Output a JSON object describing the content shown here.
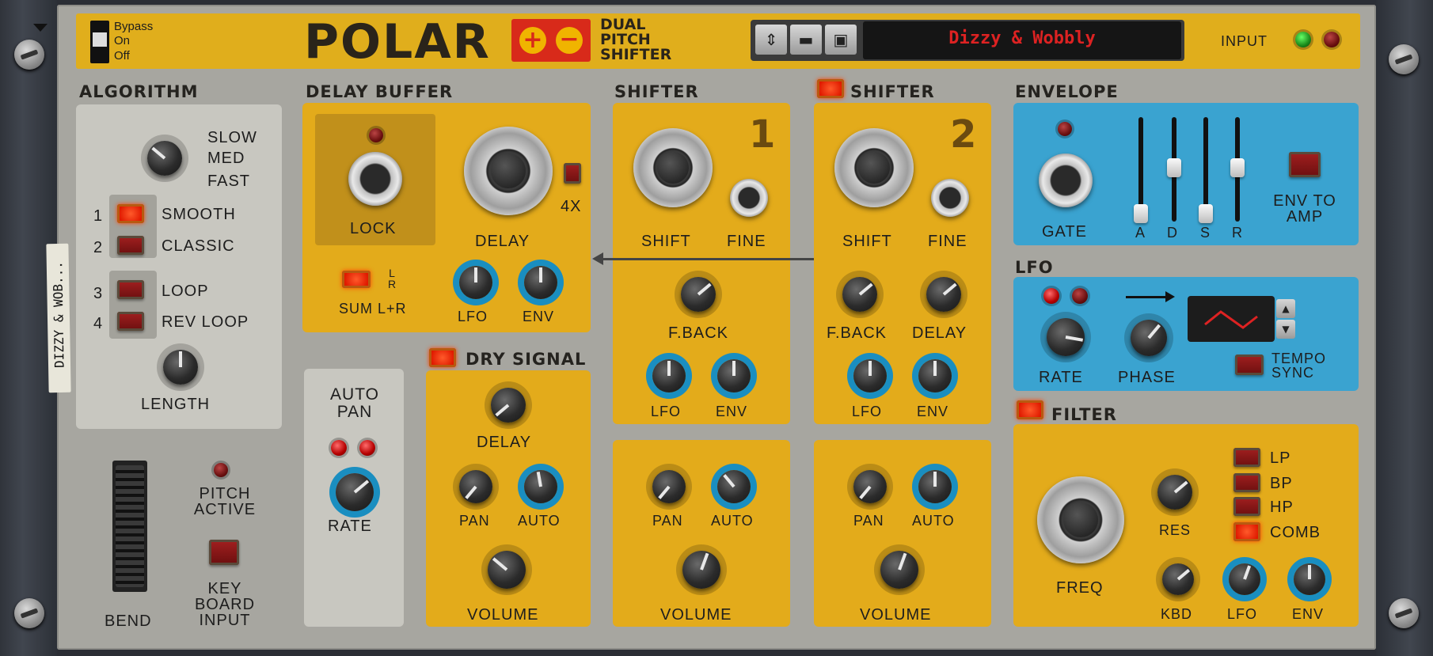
{
  "header": {
    "bypass": "Bypass",
    "on": "On",
    "off": "Off",
    "title": "POLAR",
    "plus": "+",
    "minus": "−",
    "subtitle_1": "DUAL",
    "subtitle_2": "PITCH",
    "subtitle_3": "SHIFTER",
    "patch_name": "Dizzy & Wobbly",
    "input": "INPUT",
    "side_label": "DIZZY & WOB..."
  },
  "algorithm": {
    "header": "ALGORITHM",
    "slow": "SLOW",
    "med": "MED",
    "fast": "FAST",
    "n1": "1",
    "smooth": "SMOOTH",
    "n2": "2",
    "classic": "CLASSIC",
    "n3": "3",
    "loop": "LOOP",
    "n4": "4",
    "rev_loop": "REV LOOP",
    "length": "LENGTH"
  },
  "bend": {
    "bend": "BEND",
    "pitch_active": "PITCH ACTIVE",
    "keyboard_input": "KEY BOARD INPUT"
  },
  "delay_buffer": {
    "header": "DELAY BUFFER",
    "lock": "LOCK",
    "delay": "DELAY",
    "x4": "4X",
    "lr": "L\nR",
    "sum": "SUM L+R",
    "lfo": "LFO",
    "env": "ENV"
  },
  "autopan": {
    "header": "AUTO PAN",
    "rate": "RATE"
  },
  "dry": {
    "header": "DRY SIGNAL",
    "delay": "DELAY",
    "pan": "PAN",
    "auto": "AUTO",
    "volume": "VOLUME"
  },
  "shifter1": {
    "header": "SHIFTER",
    "number": "1",
    "shift": "SHIFT",
    "fine": "FINE",
    "fback": "F.BACK",
    "lfo": "LFO",
    "env": "ENV",
    "pan": "PAN",
    "auto": "AUTO",
    "volume": "VOLUME"
  },
  "shifter2": {
    "header": "SHIFTER",
    "number": "2",
    "shift": "SHIFT",
    "fine": "FINE",
    "fback": "F.BACK",
    "delay": "DELAY",
    "lfo": "LFO",
    "env": "ENV",
    "pan": "PAN",
    "auto": "AUTO",
    "volume": "VOLUME"
  },
  "envelope": {
    "header": "ENVELOPE",
    "gate": "GATE",
    "a": "A",
    "d": "D",
    "s": "S",
    "r": "R",
    "env_to_amp": "ENV TO AMP"
  },
  "lfo": {
    "header": "LFO",
    "rate": "RATE",
    "phase": "PHASE",
    "tempo_sync": "TEMPO SYNC"
  },
  "filter": {
    "header": "FILTER",
    "lp": "LP",
    "bp": "BP",
    "hp": "HP",
    "comb": "COMB",
    "freq": "FREQ",
    "res": "RES",
    "kbd": "KBD",
    "lfo": "LFO",
    "env": "ENV"
  },
  "colors": {
    "yellow": "#e3ab1b",
    "blue": "#3aa3d0",
    "grey": "#c8c7c0",
    "led_red": "#e01a00",
    "display_text": "#d22"
  },
  "icons": [
    "up-down-arrows-icon",
    "folder-icon",
    "save-icon",
    "chevron-down-icon",
    "sine-triangle-wave-icon",
    "arrow-right-icon"
  ]
}
